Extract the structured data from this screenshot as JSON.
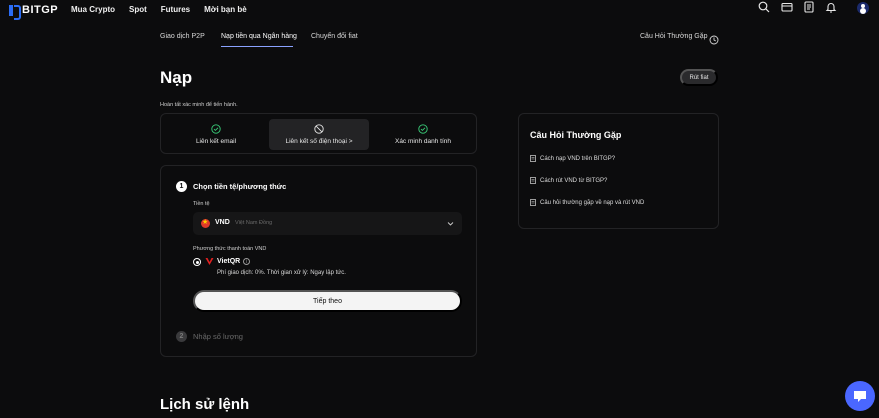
{
  "brand": {
    "name": "BITGP",
    "accent": "#2b6df5"
  },
  "nav": {
    "items": [
      "Mua Crypto",
      "Spot",
      "Futures",
      "Mời bạn bè"
    ],
    "icons": [
      "search-icon",
      "wallet-icon",
      "orders-icon",
      "bell-icon",
      "avatar"
    ]
  },
  "subtabs": [
    {
      "label": "Giao dịch P2P",
      "active": false
    },
    {
      "label": "Nạp tiền qua Ngân hàng",
      "active": true
    },
    {
      "label": "Chuyển đổi fiat",
      "active": false
    }
  ],
  "faq_link": "Câu Hỏi Thường Gặp",
  "page": {
    "title": "Nạp",
    "withdraw_label": "Rút fiat",
    "verify_note": "Hoàn tất xác minh để tiến hành."
  },
  "verification": [
    {
      "label": "Liên kết email",
      "status": "done"
    },
    {
      "label": "Liên kết số điện thoại >",
      "status": "blocked"
    },
    {
      "label": "Xác minh danh tính",
      "status": "done"
    }
  ],
  "step1": {
    "number": "1",
    "title": "Chọn tiền tệ/phương thức",
    "currency_label": "Tiền tệ",
    "currency_code": "VND",
    "currency_name": "Việt Nam Đồng",
    "method_label": "Phương thức thanh toán VND",
    "method_name": "VietQR",
    "method_info": "i",
    "method_desc": "Phí giao dịch: 0%. Thời gian xử lý: Ngay lập tức.",
    "next_label": "Tiếp theo"
  },
  "step2": {
    "number": "2",
    "title": "Nhập số lượng"
  },
  "faq": {
    "title": "Câu Hỏi Thường Gặp",
    "items": [
      "Cách nạp VND trên BITGP?",
      "Cách rút VND từ BITGP?",
      "Câu hỏi thường gặp về nạp và rút VND"
    ]
  },
  "history_title": "Lịch sử lệnh"
}
